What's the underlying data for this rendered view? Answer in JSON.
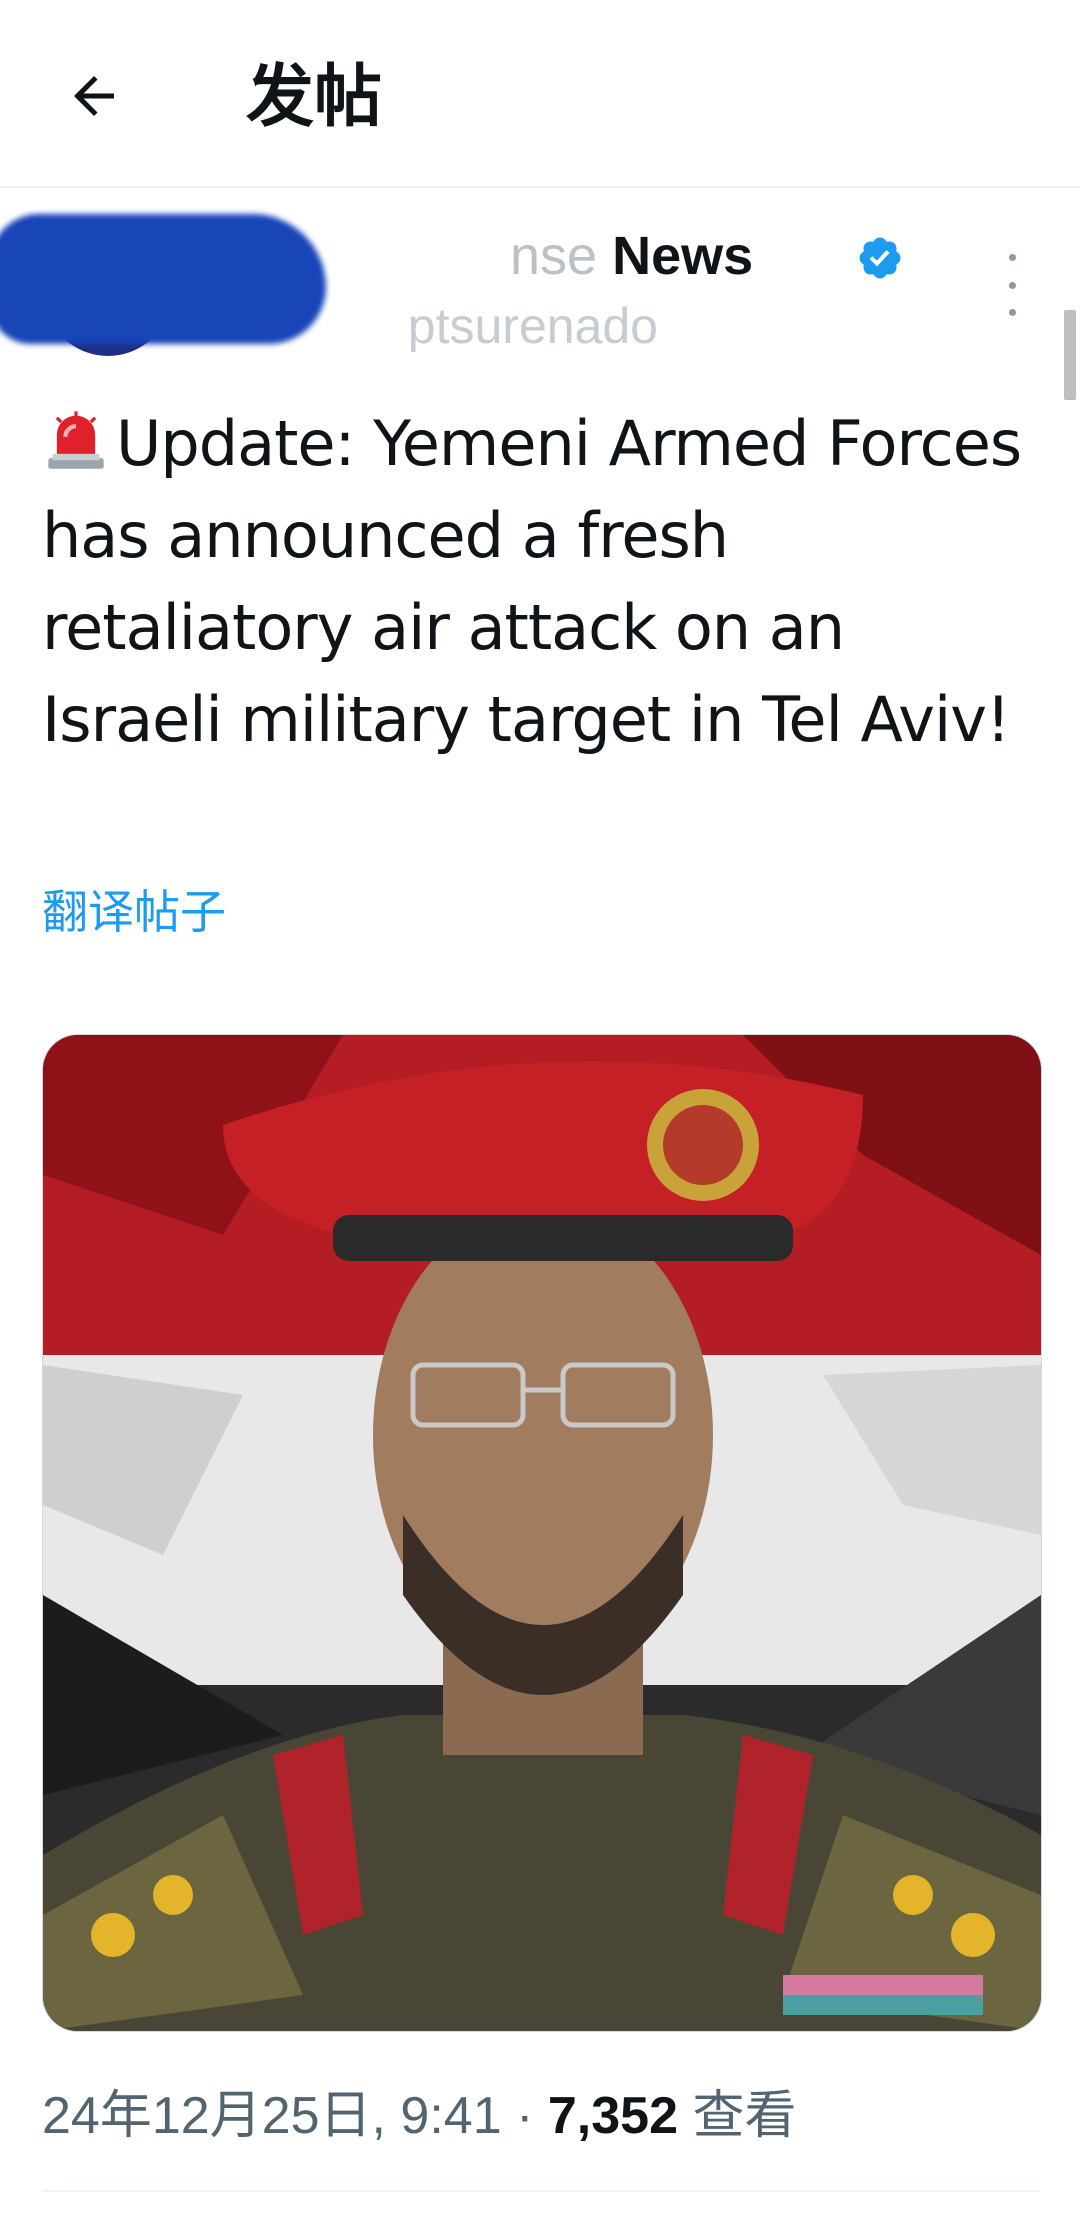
{
  "header": {
    "back_icon": "arrow-left-icon",
    "title": "发帖"
  },
  "post": {
    "author": {
      "name_faded": "nse",
      "name": "News",
      "handle": "ptsurenado",
      "verified": true,
      "verified_icon": "verified-badge-icon",
      "verified_color": "#1d9bf0"
    },
    "more_icon": "more-vertical-icon",
    "emoji": "police-siren-icon",
    "text": "Update: Yemeni Armed Forces has announced a fresh retaliatory air attack on an Israeli military target in Tel Aviv!",
    "translate_label": "翻译帖子",
    "timestamp": "24年12月25日, 9:41",
    "separator": "·",
    "views_count": "7,352",
    "views_label": "查看"
  },
  "colors": {
    "link": "#1d9bf0",
    "secondary_text": "#536471",
    "redaction": "#1845b8"
  }
}
